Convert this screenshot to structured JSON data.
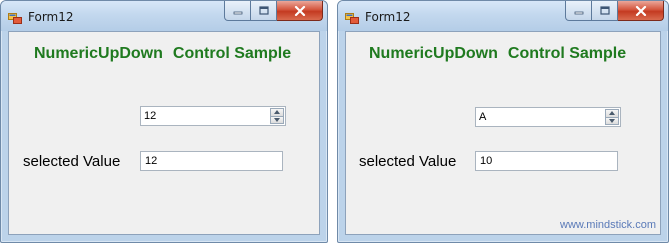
{
  "windows": [
    {
      "title": "Form12",
      "heading_part1": "NumericUpDown",
      "heading_part2": "Control Sample",
      "numeric_value": "12",
      "selected_label": "selected Value",
      "selected_value": "12"
    },
    {
      "title": "Form12",
      "heading_part1": "NumericUpDown",
      "heading_part2": "Control Sample",
      "numeric_value": "A",
      "selected_label": "selected Value",
      "selected_value": "10"
    }
  ],
  "watermark": "www.mindstick.com",
  "colors": {
    "heading": "#1f7a1f",
    "titlebar": "#c3d8ee",
    "client": "#f0f0f0",
    "close_button": "#c43a21",
    "watermark": "#5a7ab8"
  },
  "icons": [
    "form-app-icon",
    "minimize-icon",
    "maximize-icon",
    "close-icon",
    "spin-up-icon",
    "spin-down-icon"
  ]
}
